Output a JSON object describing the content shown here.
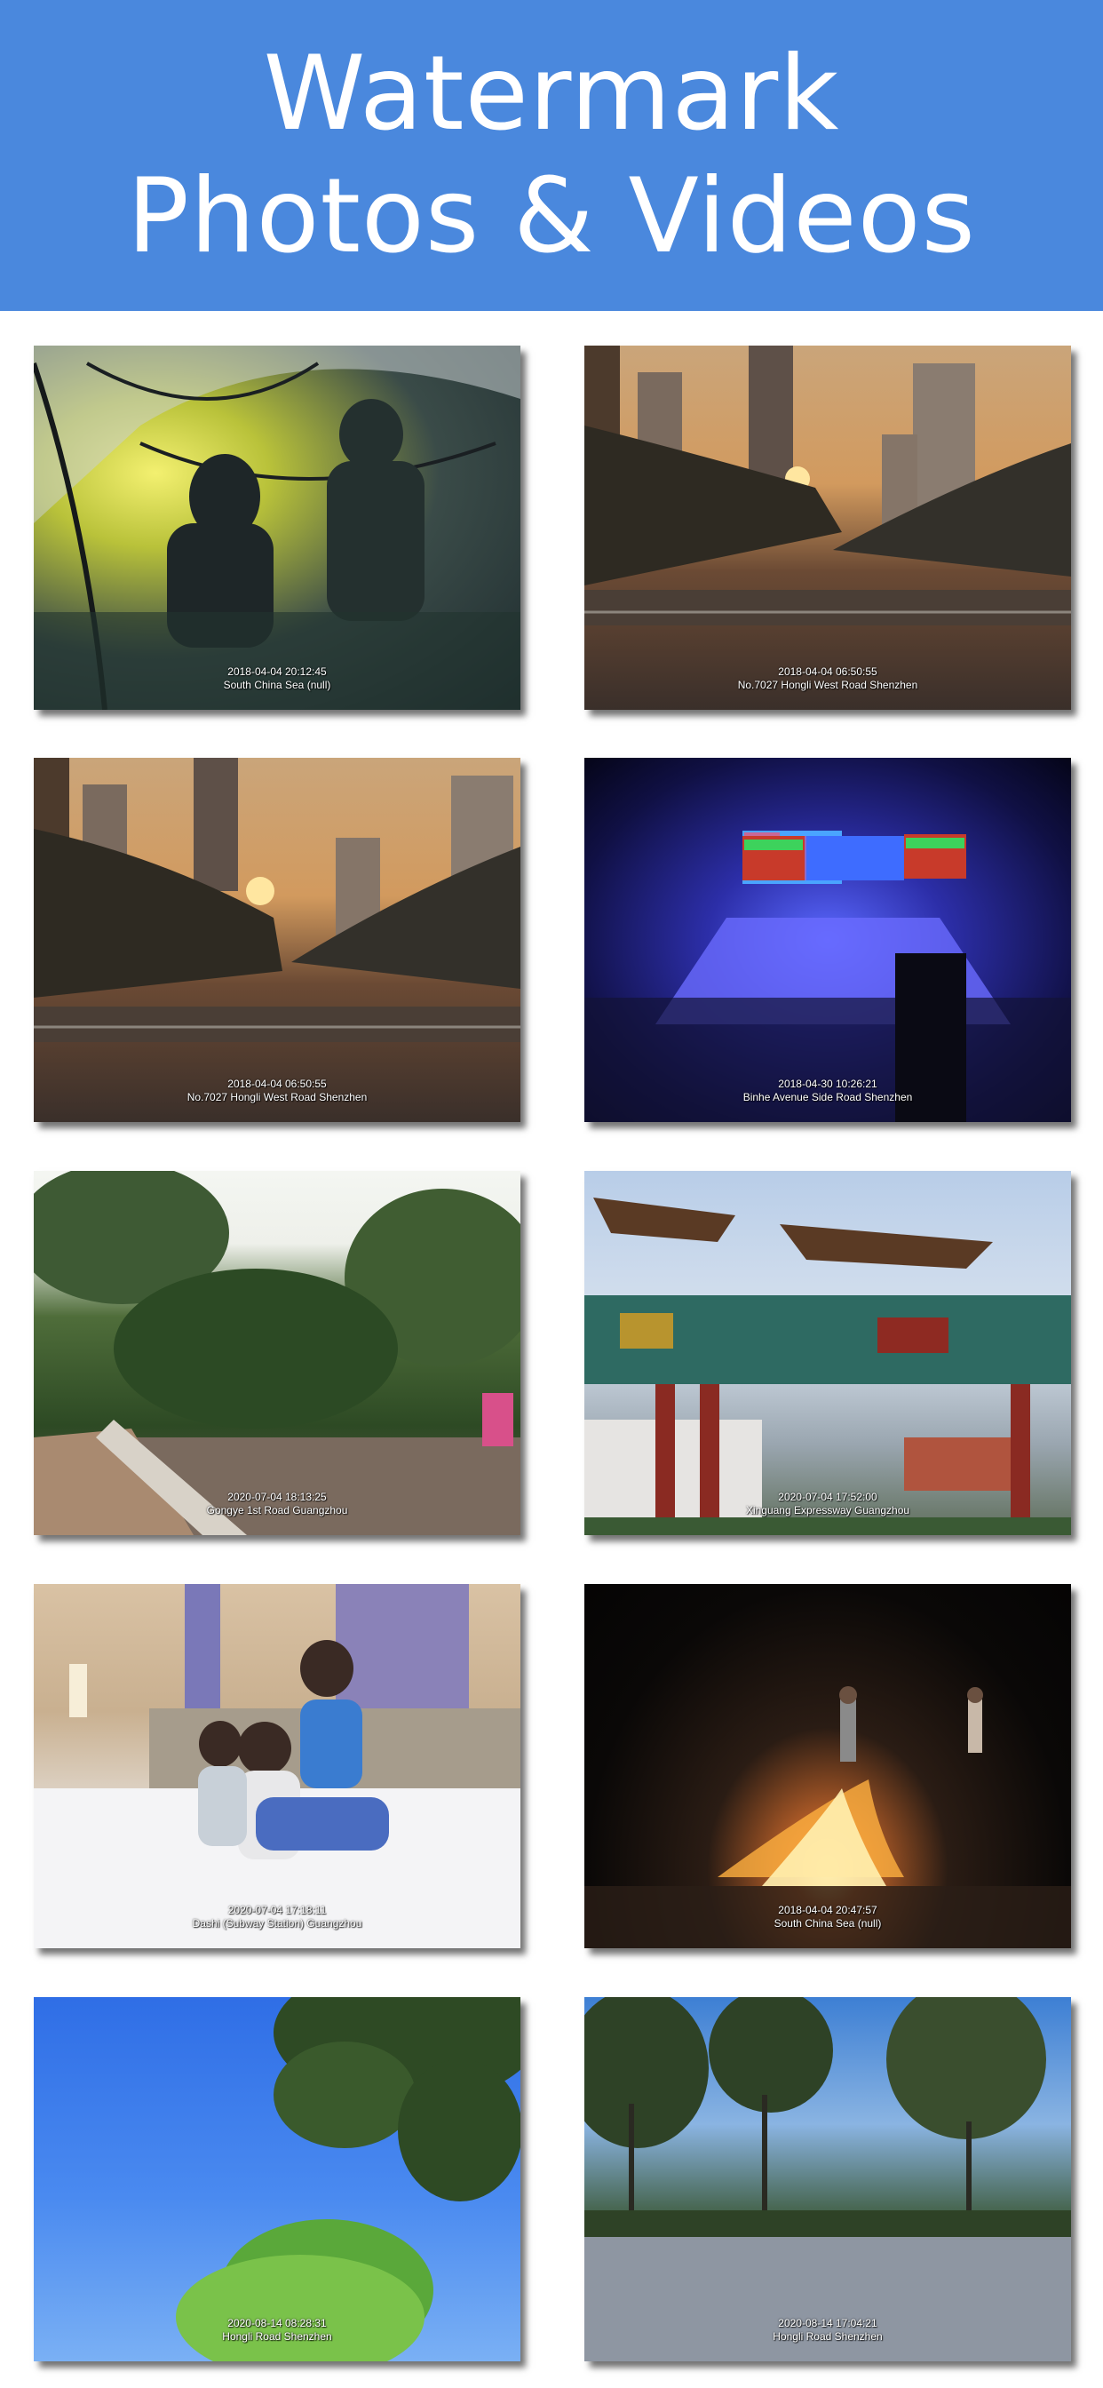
{
  "header": {
    "title_line1": "Watermark",
    "title_line2": "Photos & Videos",
    "background": "#4a88dd"
  },
  "photos": [
    {
      "time": "2018-04-04 20:12:45",
      "place": "South China Sea (null)"
    },
    {
      "time": "2018-04-04 06:50:55",
      "place": "No.7027 Hongli West Road Shenzhen"
    },
    {
      "time": "2018-04-04 06:50:55",
      "place": "No.7027 Hongli West Road Shenzhen"
    },
    {
      "time": "2018-04-30 10:26:21",
      "place": "Binhe Avenue Side Road Shenzhen"
    },
    {
      "time": "2020-07-04 18:13:25",
      "place": "Gongye 1st Road Guangzhou"
    },
    {
      "time": "2020-07-04 17:52:00",
      "place": "Xinguang Expressway Guangzhou"
    },
    {
      "time": "2020-07-04 17:18:11",
      "place": "Dashi (Subway Station) Guangzhou"
    },
    {
      "time": "2018-04-04 20:47:57",
      "place": "South China Sea (null)"
    },
    {
      "time": "2020-08-14 08:28:31",
      "place": "Hongli Road Shenzhen"
    },
    {
      "time": "2020-08-14 17:04:21",
      "place": "Hongli Road Shenzhen"
    }
  ]
}
